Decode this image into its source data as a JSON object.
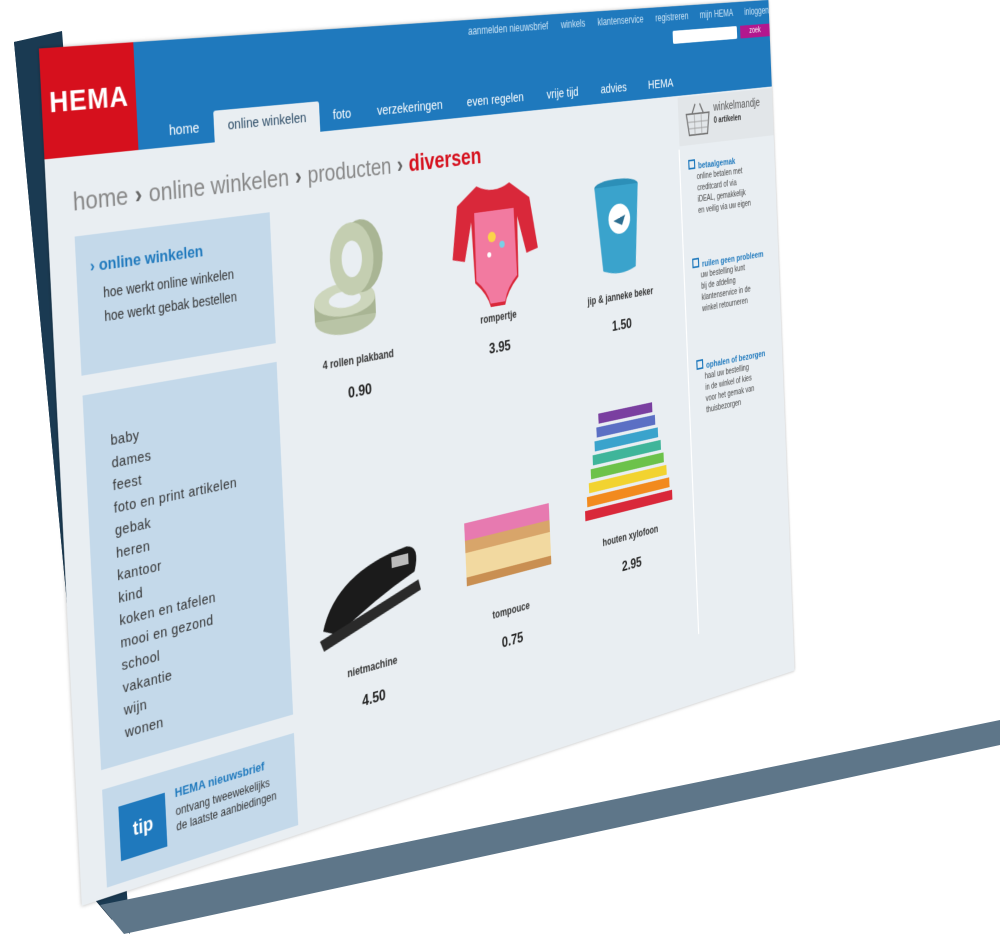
{
  "header": {
    "logo": "HEMA",
    "top_links": [
      "aanmelden nieuwsbrief",
      "winkels",
      "klantenservice",
      "registreren",
      "mijn HEMA",
      "inloggen"
    ],
    "search_button": "zoek",
    "nav_tabs": [
      "home",
      "online winkelen",
      "foto",
      "verzekeringen",
      "even regelen",
      "vrije tijd",
      "advies",
      "HEMA"
    ]
  },
  "basket": {
    "title": "winkelmandje",
    "count": "0 artikelen"
  },
  "breadcrumb": {
    "items": [
      "home",
      "online winkelen",
      "producten"
    ],
    "current": "diversen",
    "separator": "›"
  },
  "sidebar": {
    "heading": "online winkelen",
    "links": [
      "hoe werkt online winkelen",
      "hoe werkt gebak bestellen"
    ],
    "categories": [
      "baby",
      "dames",
      "feest",
      "foto en print artikelen",
      "gebak",
      "heren",
      "kantoor",
      "kind",
      "koken en tafelen",
      "mooi en gezond",
      "school",
      "vakantie",
      "wijn",
      "wonen"
    ]
  },
  "tip": {
    "badge": "tip",
    "title": "HEMA nieuwsbrief",
    "lines": [
      "ontvang tweewekelijks",
      "de laatste aanbiedingen"
    ]
  },
  "products": [
    {
      "name": "4 rollen plakband",
      "price": "0.90",
      "icon": "tape-rolls-icon"
    },
    {
      "name": "rompertje",
      "price": "3.95",
      "icon": "baby-bodysuit-icon"
    },
    {
      "name": "jip & janneke beker",
      "price": "1.50",
      "icon": "cup-icon"
    },
    {
      "name": "nietmachine",
      "price": "4.50",
      "icon": "stapler-icon"
    },
    {
      "name": "tompouce",
      "price": "0.75",
      "icon": "pastry-icon"
    },
    {
      "name": "houten xylofoon",
      "price": "2.95",
      "icon": "xylophone-icon"
    }
  ],
  "info_blocks": [
    {
      "title": "betaalgemak",
      "lines": [
        "online betalen met",
        "creditcard of via",
        "iDEAL, gemakkelijk",
        "en veilig via uw eigen"
      ]
    },
    {
      "title": "ruilen geen probleem",
      "lines": [
        "uw bestelling kunt",
        "bij de afdeling",
        "klantenservice in de",
        "winkel retourneren"
      ]
    },
    {
      "title": "ophalen of bezorgen",
      "lines": [
        "haal uw bestelling",
        "in de winkel of kies",
        "voor het gemak van",
        "thuisbezorgen"
      ]
    }
  ],
  "colors": {
    "brand_red": "#d6101d",
    "header_blue": "#1f79bd",
    "panel_blue": "#c4d9ea",
    "search_button": "#b3178e"
  }
}
